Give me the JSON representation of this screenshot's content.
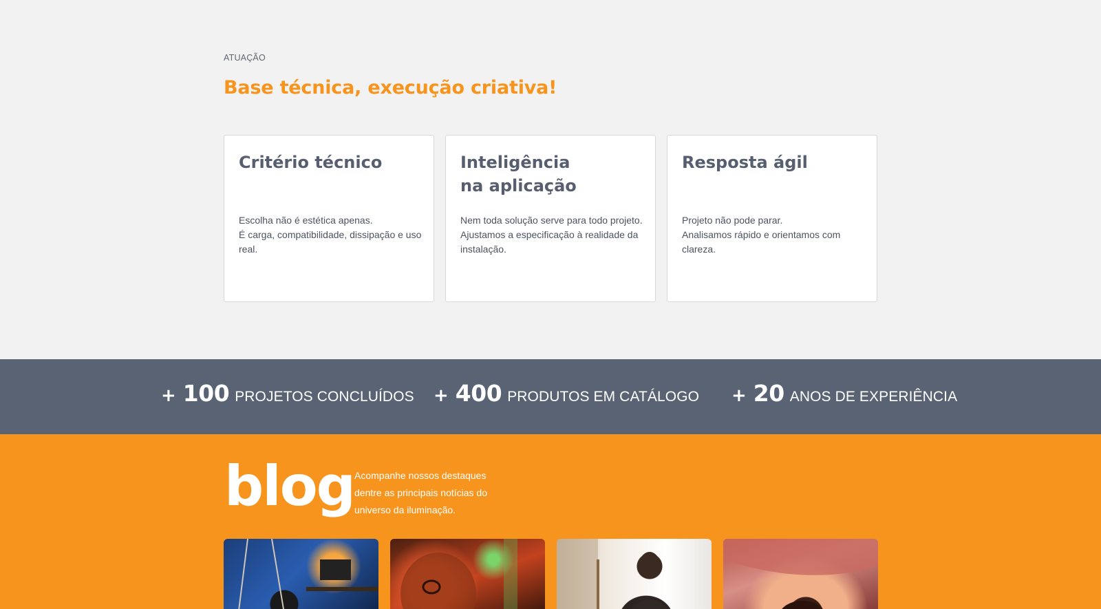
{
  "atuacao": {
    "eyebrow": "ATUAÇÃO",
    "title": "Base técnica, execução criativa!",
    "cards": [
      {
        "title": "Critério técnico",
        "text": "Escolha não é estética apenas.\nÉ carga, compatibilidade, dissipação e uso real."
      },
      {
        "title": "Inteligência\nna aplicação",
        "text": "Nem toda solução serve para todo projeto.\nAjustamos a especificação à realidade da instalação."
      },
      {
        "title": "Resposta ágil",
        "text": "Projeto não pode parar.\nAnalisamos rápido e orientamos com clareza."
      }
    ]
  },
  "stats": [
    {
      "plus": "+",
      "number": "100",
      "label": "PROJETOS CONCLUÍDOS"
    },
    {
      "plus": "+",
      "number": "400",
      "label": "PRODUTOS EM CATÁLOGO"
    },
    {
      "plus": "+",
      "number": "20",
      "label": "ANOS DE EXPERIÊNCIA"
    }
  ],
  "blog": {
    "title": "blog",
    "description": "Acompanhe nossos destaques\ndentre as principais notícias do\nuniverso da iluminação.",
    "thumbnails": [
      {
        "name": "blog-thumbnail-1"
      },
      {
        "name": "blog-thumbnail-2"
      },
      {
        "name": "blog-thumbnail-3"
      },
      {
        "name": "blog-thumbnail-4"
      }
    ]
  },
  "colors": {
    "accent": "#f7941d",
    "stats_bg": "#5a6374",
    "page_bg": "#f2f2f2",
    "card_title": "#565e6f"
  }
}
